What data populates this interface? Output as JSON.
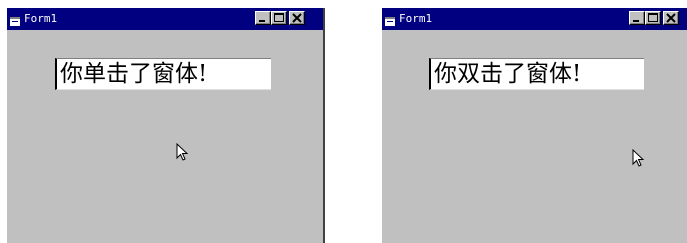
{
  "windows": [
    {
      "title": "Form1",
      "label_text": "你单击了窗体!"
    },
    {
      "title": "Form1",
      "label_text": "你双击了窗体!"
    }
  ],
  "icons": {
    "system_menu": "form-icon",
    "minimize": "minimize-icon",
    "maximize": "maximize-icon",
    "close": "close-icon",
    "cursor": "arrow-cursor-icon"
  },
  "colors": {
    "titlebar": "#000080",
    "title_text": "#ffffff",
    "client_area": "#c0c0c0",
    "label_background": "#ffffff"
  }
}
